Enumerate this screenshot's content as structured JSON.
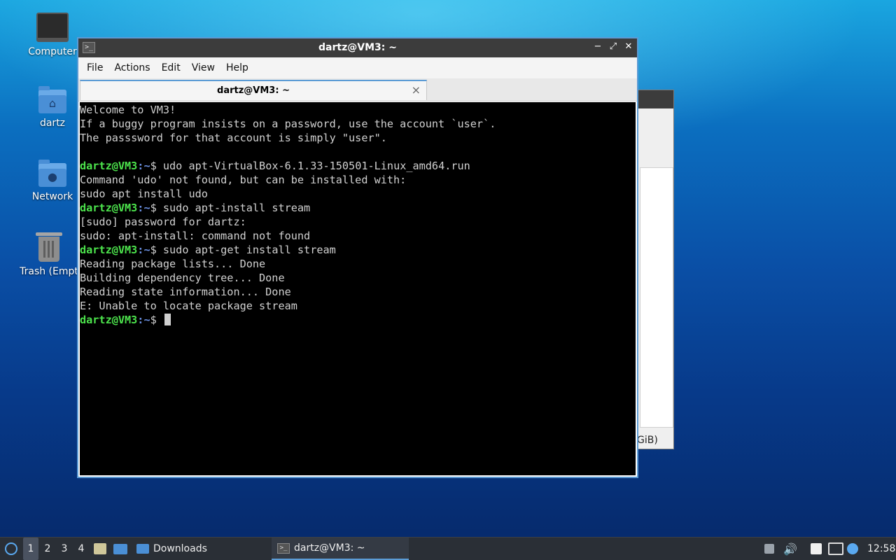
{
  "desktop": {
    "icons": [
      {
        "label": "Computer"
      },
      {
        "label": "dartz"
      },
      {
        "label": "Network"
      },
      {
        "label": "Trash (Empt"
      }
    ]
  },
  "background_window": {
    "partial_text": "GiB)"
  },
  "terminal": {
    "window_title": "dartz@VM3: ~",
    "menu": [
      "File",
      "Actions",
      "Edit",
      "View",
      "Help"
    ],
    "tab_title": "dartz@VM3: ~",
    "tab_close": "×",
    "prompt_user": "dartz@VM3",
    "prompt_path": ":~",
    "prompt_symbol": "$",
    "lines": [
      {
        "type": "out",
        "text": "Welcome to VM3!"
      },
      {
        "type": "out",
        "text": "If a buggy program insists on a password, use the account `user`."
      },
      {
        "type": "out",
        "text": "The passsword for that account is simply \"user\"."
      },
      {
        "type": "out",
        "text": ""
      },
      {
        "type": "cmd",
        "text": " udo apt-VirtualBox-6.1.33-150501-Linux_amd64.run"
      },
      {
        "type": "out",
        "text": "Command 'udo' not found, but can be installed with:"
      },
      {
        "type": "out",
        "text": "sudo apt install udo"
      },
      {
        "type": "cmd",
        "text": " sudo apt-install stream"
      },
      {
        "type": "out",
        "text": "[sudo] password for dartz:"
      },
      {
        "type": "out",
        "text": "sudo: apt-install: command not found"
      },
      {
        "type": "cmd",
        "text": " sudo apt-get install stream"
      },
      {
        "type": "out",
        "text": "Reading package lists... Done"
      },
      {
        "type": "out",
        "text": "Building dependency tree... Done"
      },
      {
        "type": "out",
        "text": "Reading state information... Done"
      },
      {
        "type": "out",
        "text": "E: Unable to locate package stream"
      },
      {
        "type": "cmd",
        "text": " ",
        "cursor": true
      }
    ]
  },
  "taskbar": {
    "workspaces": [
      "1",
      "2",
      "3",
      "4"
    ],
    "active_workspace": "1",
    "downloads_label": "Downloads",
    "task_label": "dartz@VM3: ~",
    "clock": "12:58"
  },
  "colors": {
    "prompt": "#4ce34c",
    "path": "#6a8fe0",
    "accent": "#5b9bd5"
  }
}
